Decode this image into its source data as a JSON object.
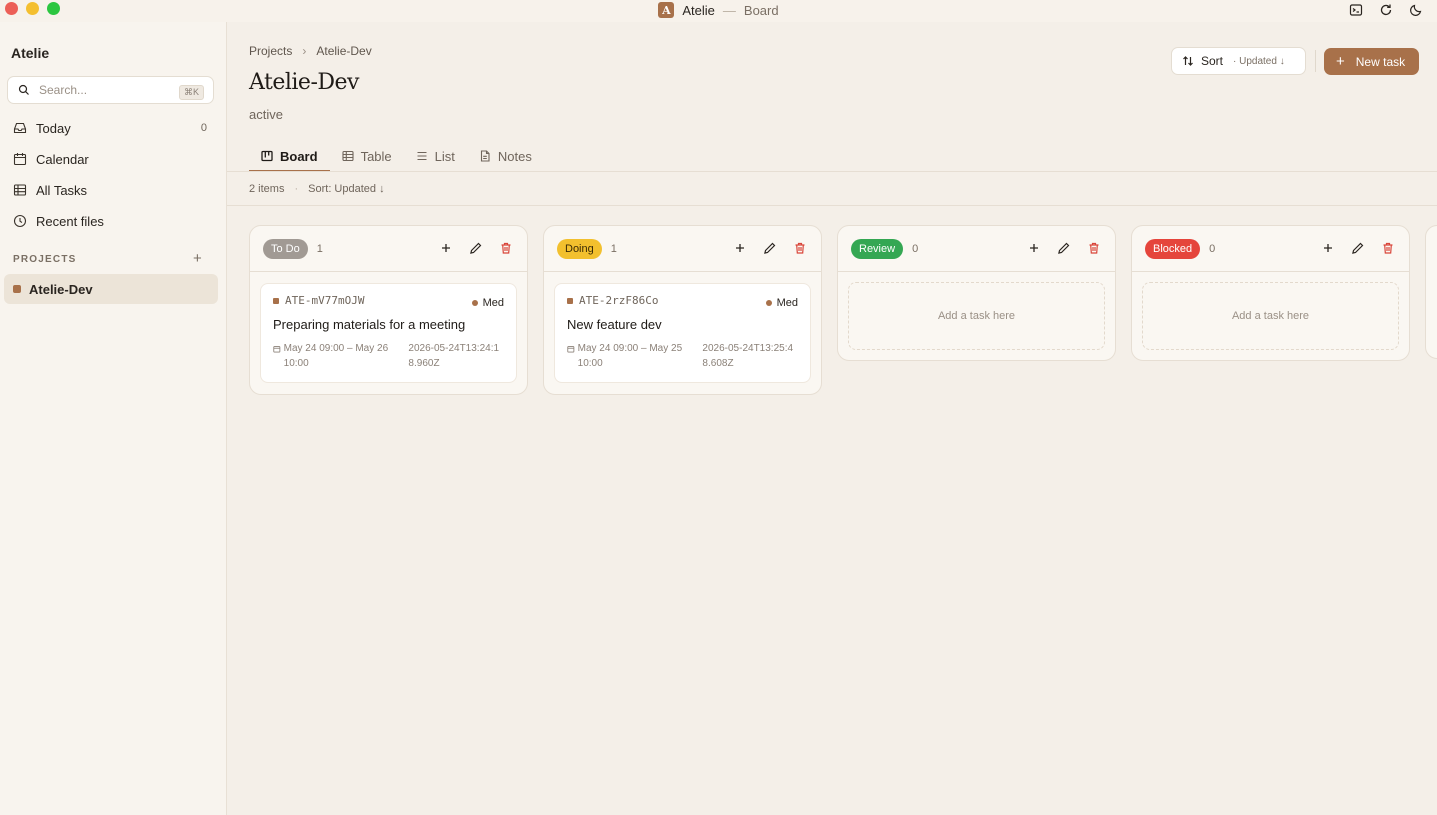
{
  "window": {
    "app_name": "Atelie",
    "badge_letter": "A",
    "separator": "—",
    "view_name": "Board"
  },
  "sidebar": {
    "app_name": "Atelie",
    "search_placeholder": "Search...",
    "search_shortcut": "⌘K",
    "nav": [
      {
        "label": "Today",
        "count": "0",
        "icon": "inbox-icon"
      },
      {
        "label": "Calendar",
        "count": "",
        "icon": "calendar-icon"
      },
      {
        "label": "All Tasks",
        "count": "",
        "icon": "table-icon"
      },
      {
        "label": "Recent files",
        "count": "",
        "icon": "clock-icon"
      }
    ],
    "projects_label": "PROJECTS",
    "projects": [
      {
        "label": "Atelie-Dev",
        "color": "#a8714a"
      }
    ]
  },
  "header": {
    "breadcrumb": [
      "Projects",
      "Atelie-Dev"
    ],
    "breadcrumb_sep": "›",
    "title": "Atelie-Dev",
    "subtitle": "active",
    "sort_label": "Sort",
    "sort_meta": "· Updated ↓",
    "new_task_label": "New task"
  },
  "tabs": [
    {
      "label": "Board",
      "active": true,
      "icon": "board-icon"
    },
    {
      "label": "Table",
      "active": false,
      "icon": "table-icon"
    },
    {
      "label": "List",
      "active": false,
      "icon": "list-icon"
    },
    {
      "label": "Notes",
      "active": false,
      "icon": "notes-icon"
    }
  ],
  "meta": {
    "items": "2 items",
    "dot": "·",
    "sort": "Sort: Updated ↓"
  },
  "columns": [
    {
      "status": "To Do",
      "count": "1",
      "pill_bg": "#a19a94",
      "pill_fg": "#ffffff",
      "cards": [
        {
          "id": "ATE-mV77mOJW",
          "priority": "Med",
          "title": "Preparing materials for a meeting",
          "range": "May 24 09:00 – May 26 10:00",
          "timestamp": "2026-05-24T13:24:18.960Z"
        }
      ]
    },
    {
      "status": "Doing",
      "count": "1",
      "pill_bg": "#f2c02e",
      "pill_fg": "#3a2a05",
      "cards": [
        {
          "id": "ATE-2rzF86Co",
          "priority": "Med",
          "title": "New feature dev",
          "range": "May 24 09:00 – May 25 10:00",
          "timestamp": "2026-05-24T13:25:48.608Z"
        }
      ]
    },
    {
      "status": "Review",
      "count": "0",
      "pill_bg": "#34a753",
      "pill_fg": "#ffffff",
      "empty_label": "Add a task here",
      "cards": []
    },
    {
      "status": "Blocked",
      "count": "0",
      "pill_bg": "#e5453c",
      "pill_fg": "#ffffff",
      "empty_label": "Add a task here",
      "cards": []
    }
  ],
  "colors": {
    "accent": "#a8714a",
    "delete": "#d9453a"
  }
}
